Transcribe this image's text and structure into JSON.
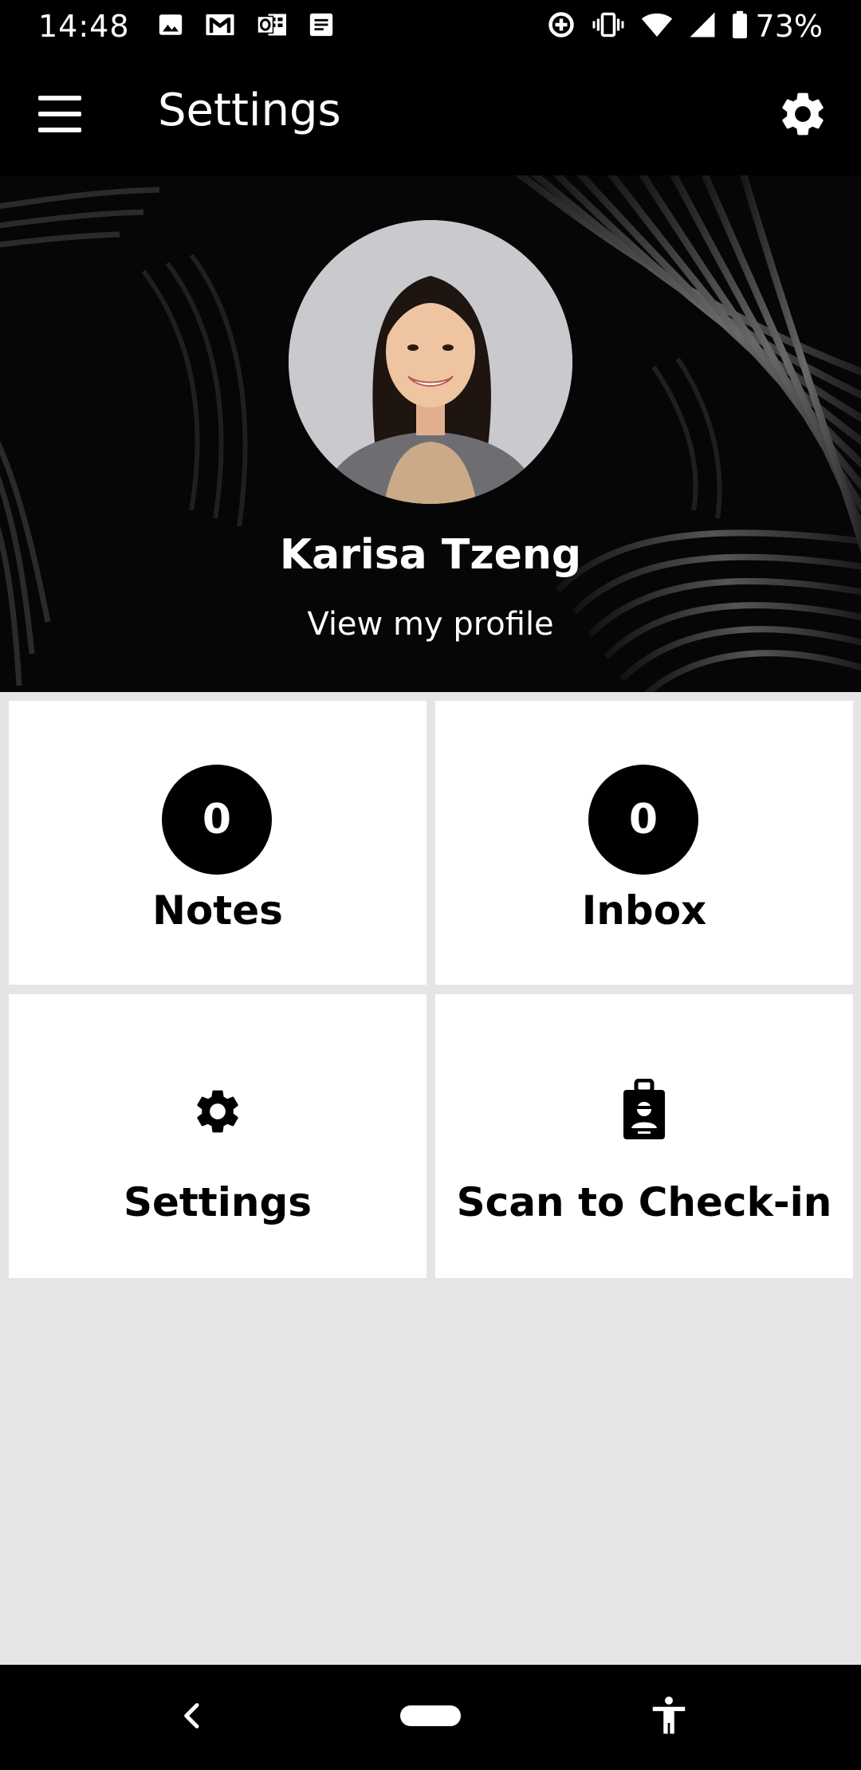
{
  "status_bar": {
    "time": "14:48",
    "battery": "73%",
    "left_icons": [
      "image-icon",
      "gmail-icon",
      "outlook-icon",
      "notes-icon"
    ],
    "right_icons": [
      "data-saver-icon",
      "vibrate-icon",
      "wifi-icon",
      "signal-icon",
      "battery-icon"
    ]
  },
  "app_bar": {
    "title": "Settings",
    "menu_icon": "hamburger-menu-icon",
    "action_icon": "gear-icon"
  },
  "profile": {
    "name": "Karisa Tzeng",
    "link": "View my profile"
  },
  "tiles": {
    "notes": {
      "count": "0",
      "label": "Notes"
    },
    "inbox": {
      "count": "0",
      "label": "Inbox"
    },
    "settings": {
      "label": "Settings",
      "icon": "gear-icon"
    },
    "scan": {
      "label": "Scan to Check-in",
      "icon": "badge-icon"
    }
  },
  "nav_bar": {
    "back_icon": "back-chevron-icon",
    "home_icon": "home-pill-icon",
    "accessibility_icon": "accessibility-icon"
  },
  "colors": {
    "background": "#e5e5e5",
    "bars": "#000000",
    "tile": "#ffffff"
  }
}
